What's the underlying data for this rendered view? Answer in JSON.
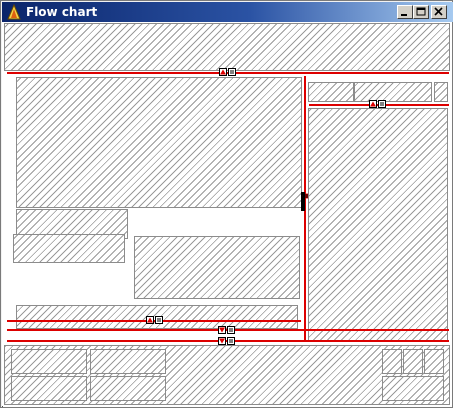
{
  "window": {
    "title": "Flow chart",
    "icon": "app-flame-icon",
    "controls": {
      "minimize_icon": "minimize-icon",
      "maximize_icon": "maximize-icon",
      "close_icon": "close-icon"
    }
  },
  "colors": {
    "splitter_line": "#dd0000",
    "title_gradient_start": "#0a246a",
    "title_gradient_end": "#a6caf0",
    "hatch": "#9a9a9a",
    "panel_border": "#8c8c8c"
  },
  "splitter_handles": [
    {
      "name": "top-horizontal-splitter",
      "direction": "up"
    },
    {
      "name": "right-top-splitter",
      "direction": "up"
    },
    {
      "name": "vertical-splitter",
      "direction": "left"
    },
    {
      "name": "lower-left-splitter",
      "direction": "up"
    },
    {
      "name": "lower-splitter-1",
      "direction": "down"
    },
    {
      "name": "lower-splitter-2",
      "direction": "down"
    }
  ]
}
